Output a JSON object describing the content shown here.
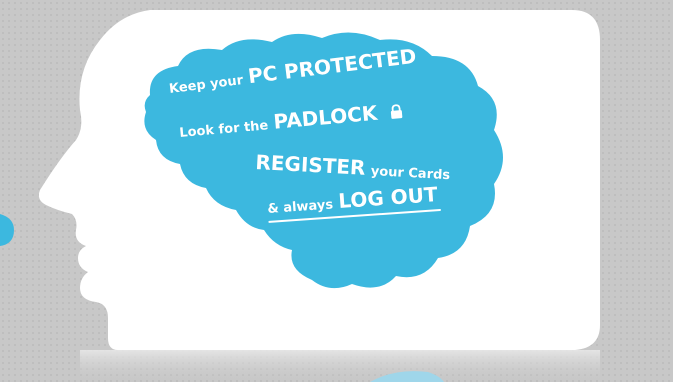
{
  "messages": {
    "line1": {
      "prefix": "Keep your",
      "emphasis": "PC PROTECTED"
    },
    "line2": {
      "prefix": "Look for the",
      "emphasis": "PADLOCK",
      "icon": "padlock-icon"
    },
    "line3": {
      "emphasis": "REGISTER",
      "suffix": "your Cards"
    },
    "line4": {
      "prefix": "& always",
      "emphasis": "LOG OUT"
    }
  },
  "colors": {
    "background": "#c9c9c9",
    "head": "#ffffff",
    "brain": "#3cb8df",
    "text": "#ffffff"
  }
}
